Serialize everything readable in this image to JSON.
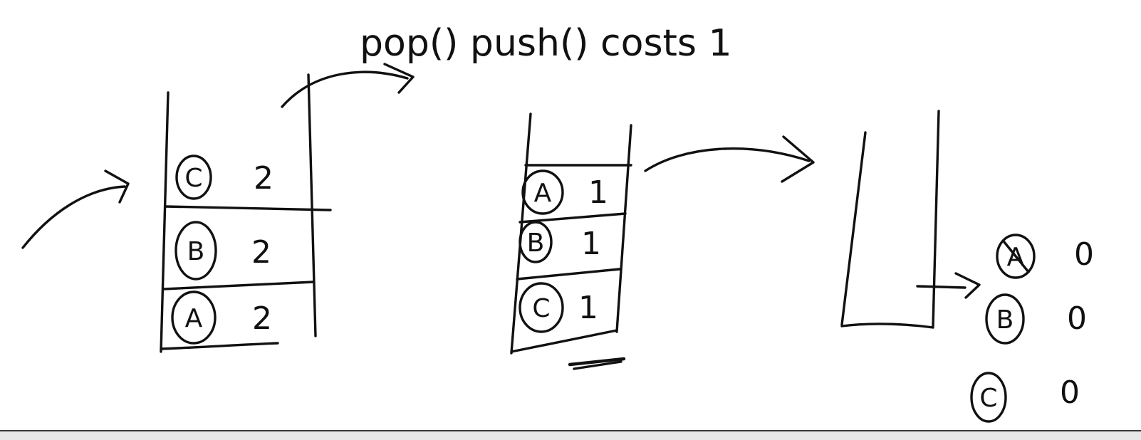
{
  "title": "pop() push() costs 1",
  "stacks": [
    {
      "id": "stack-1",
      "items": [
        {
          "letter": "C",
          "count": "2"
        },
        {
          "letter": "B",
          "count": "2"
        },
        {
          "letter": "A",
          "count": "2"
        }
      ]
    },
    {
      "id": "stack-2",
      "items": [
        {
          "letter": "A",
          "count": "1"
        },
        {
          "letter": "B",
          "count": "1"
        },
        {
          "letter": "C",
          "count": "1"
        }
      ]
    },
    {
      "id": "stack-3",
      "items": []
    }
  ],
  "popped_items": [
    {
      "letter": "A",
      "count": "0"
    },
    {
      "letter": "B",
      "count": "0"
    },
    {
      "letter": "C",
      "count": "0"
    }
  ]
}
